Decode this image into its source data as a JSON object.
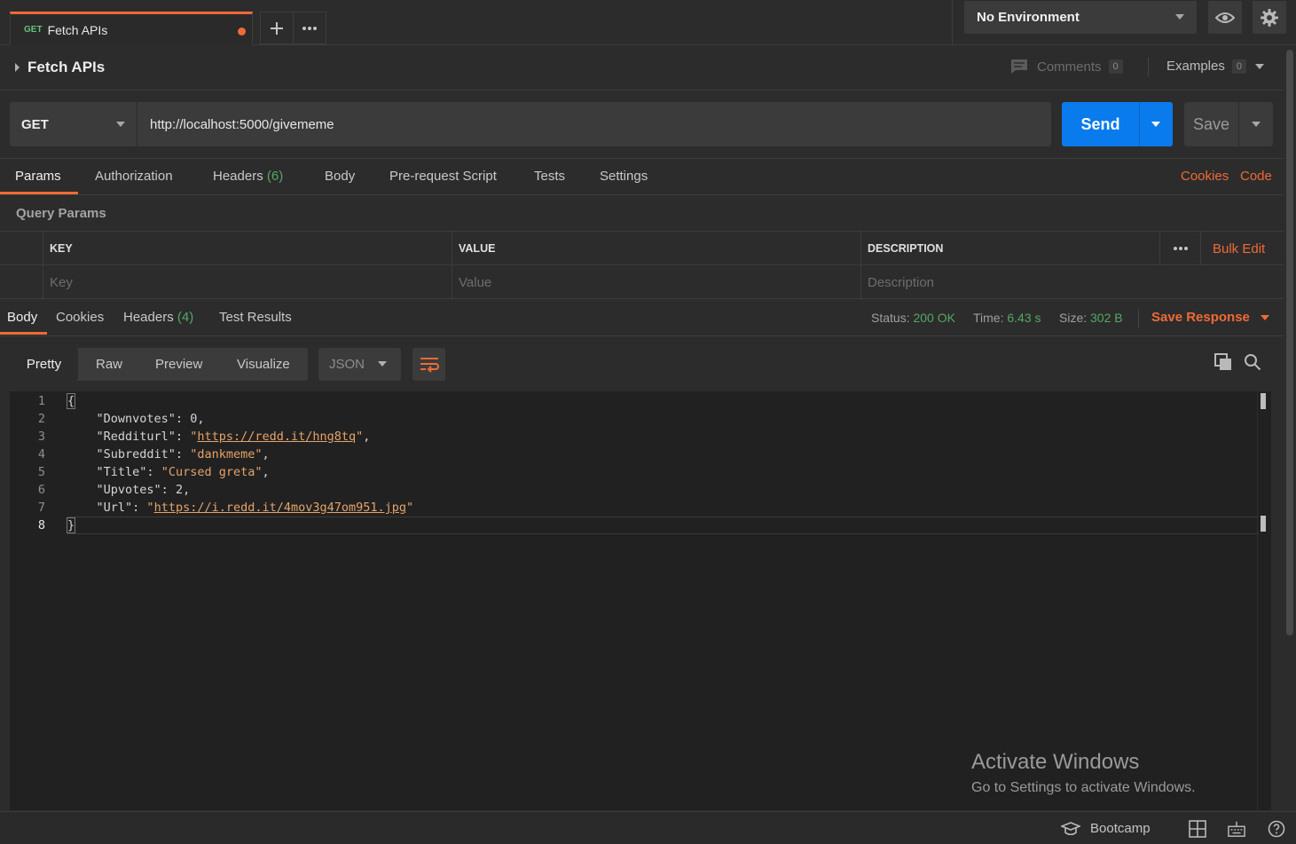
{
  "tab": {
    "method": "GET",
    "title": "Fetch APIs"
  },
  "environment": {
    "selected": "No Environment"
  },
  "request": {
    "name": "Fetch APIs",
    "comments_label": "Comments",
    "comments_count": "0",
    "examples_label": "Examples",
    "examples_count": "0",
    "method": "GET",
    "url": "http://localhost:5000/givememe",
    "send_label": "Send",
    "save_label": "Save"
  },
  "request_tabs": {
    "params": "Params",
    "authorization": "Authorization",
    "headers": "Headers",
    "headers_count": "(6)",
    "body": "Body",
    "prerequest": "Pre-request Script",
    "tests": "Tests",
    "settings": "Settings",
    "cookies_link": "Cookies",
    "code_link": "Code"
  },
  "query_params": {
    "label": "Query Params",
    "columns": [
      "KEY",
      "VALUE",
      "DESCRIPTION"
    ],
    "bulk_edit": "Bulk Edit",
    "placeholders": [
      "Key",
      "Value",
      "Description"
    ]
  },
  "response_tabs": {
    "body": "Body",
    "cookies": "Cookies",
    "headers": "Headers",
    "headers_count": "(4)",
    "test_results": "Test Results"
  },
  "response_status": {
    "status_label": "Status:",
    "status_value": "200 OK",
    "time_label": "Time:",
    "time_value": "6.43 s",
    "size_label": "Size:",
    "size_value": "302 B",
    "save_response": "Save Response"
  },
  "response_format": {
    "views": [
      "Pretty",
      "Raw",
      "Preview",
      "Visualize"
    ],
    "active_view": "Pretty",
    "language": "JSON"
  },
  "response_body": {
    "line_numbers": [
      "1",
      "2",
      "3",
      "4",
      "5",
      "6",
      "7",
      "8"
    ],
    "open_brace": "{",
    "close_brace": "}",
    "downvotes_key": "\"Downvotes\"",
    "downvotes_value": "0",
    "redditurl_key": "\"Redditurl\"",
    "redditurl_value": "https://redd.it/hng8tq",
    "subreddit_key": "\"Subreddit\"",
    "subreddit_value": "\"dankmeme\"",
    "title_key": "\"Title\"",
    "title_value": "\"Cursed greta\"",
    "upvotes_key": "\"Upvotes\"",
    "upvotes_value": "2",
    "url_key": "\"Url\"",
    "url_value": "https://i.redd.it/4mov3g47om951.jpg"
  },
  "watermark": {
    "line1": "Activate Windows",
    "line2": "Go to Settings to activate Windows."
  },
  "statusbar": {
    "bootcamp": "Bootcamp"
  },
  "colors": {
    "accent_orange": "#ef6a35",
    "send_blue": "#097bed",
    "success_green": "#55a765",
    "background": "#2c2c2c"
  }
}
